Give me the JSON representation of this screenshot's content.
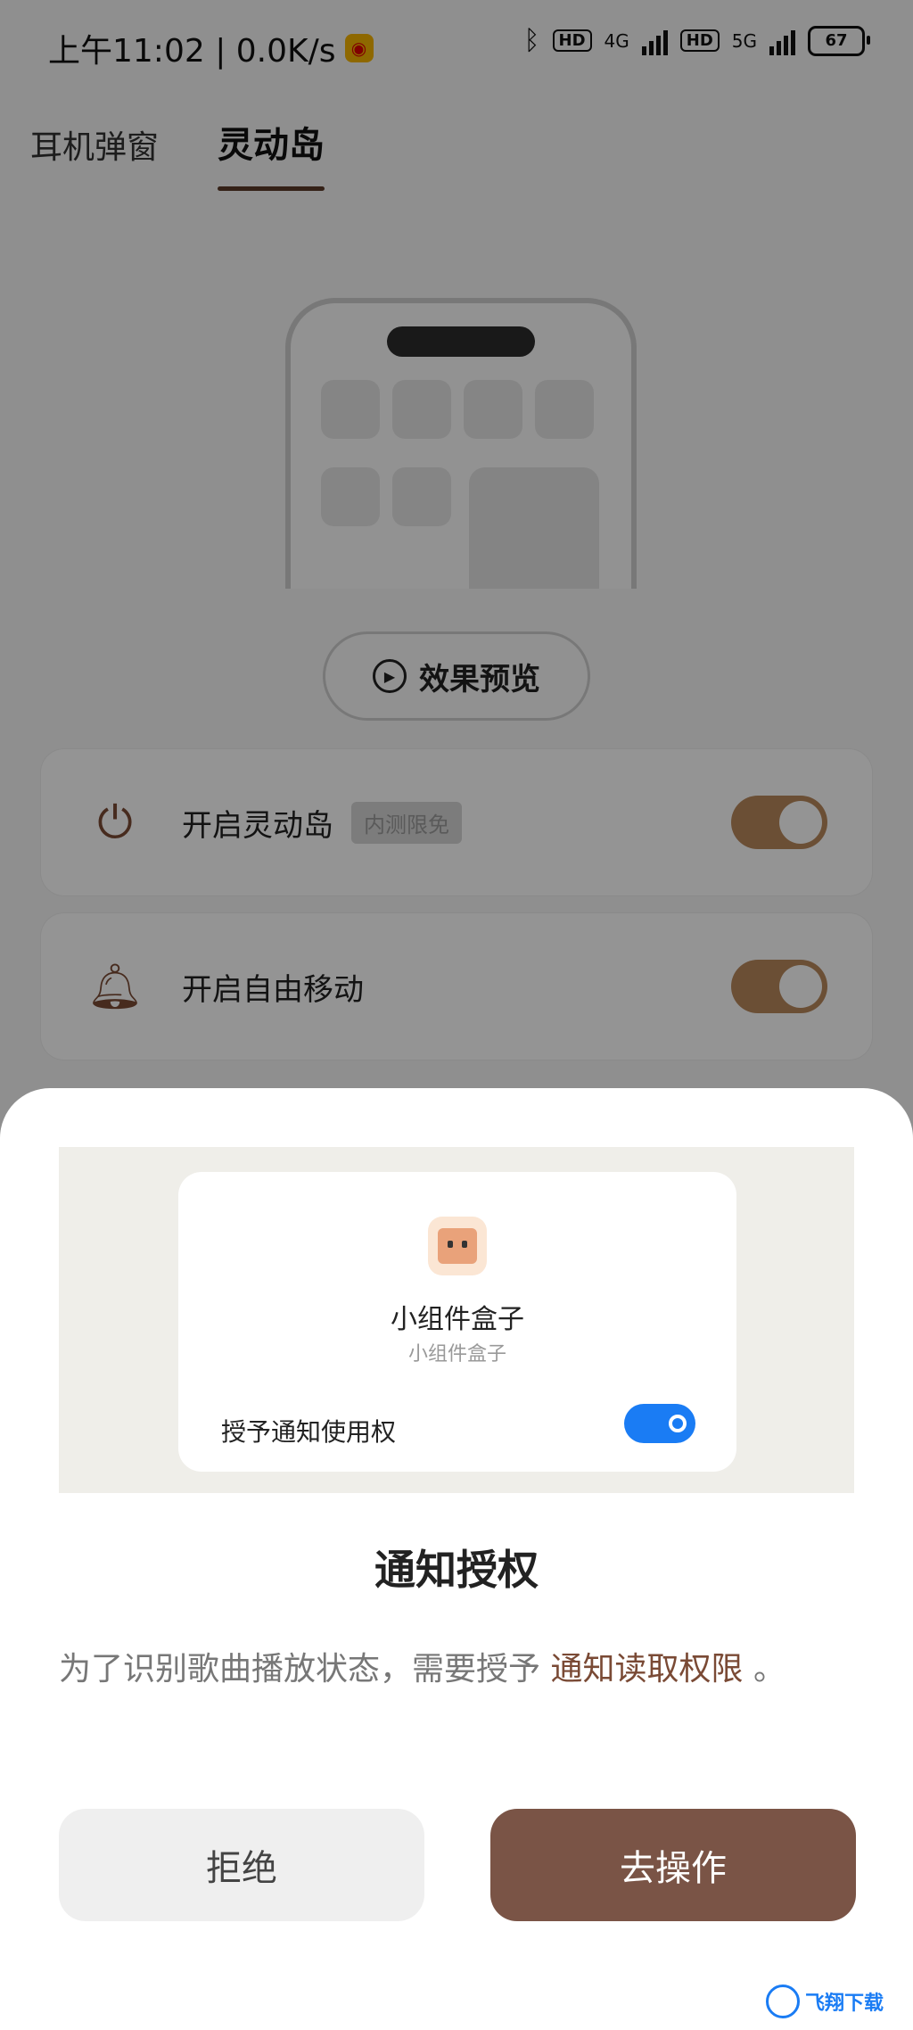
{
  "status": {
    "time_speed": "上午11:02 | 0.0K/s",
    "hd1": "HD",
    "net1": "4G",
    "hd2": "HD",
    "net2": "5G",
    "battery": "67"
  },
  "tabs": [
    {
      "label": "耳机弹窗",
      "active": false
    },
    {
      "label": "灵动岛",
      "active": true
    }
  ],
  "preview": {
    "label": "效果预览",
    "icon": "play-circle-icon"
  },
  "settings": [
    {
      "label": "开启灵动岛",
      "badge": "内测限免",
      "icon": "power-icon",
      "enabled": true
    },
    {
      "label": "开启自由移动",
      "icon": "bell-icon",
      "enabled": true
    }
  ],
  "dialog": {
    "app_name": "小组件盒子",
    "app_subtitle": "小组件盒子",
    "permission_label": "授予通知使用权",
    "permission_enabled": true,
    "title": "通知授权",
    "description_prefix": "为了识别歌曲播放状态，需要授予",
    "description_highlight": "通知读取权限",
    "description_suffix": "。",
    "reject_label": "拒绝",
    "confirm_label": "去操作"
  },
  "colors": {
    "accent_brown": "#7a5446",
    "toggle_tan": "#b8885c",
    "toggle_blue": "#1a7cf4"
  },
  "watermark": {
    "text": "飞翔下载"
  }
}
